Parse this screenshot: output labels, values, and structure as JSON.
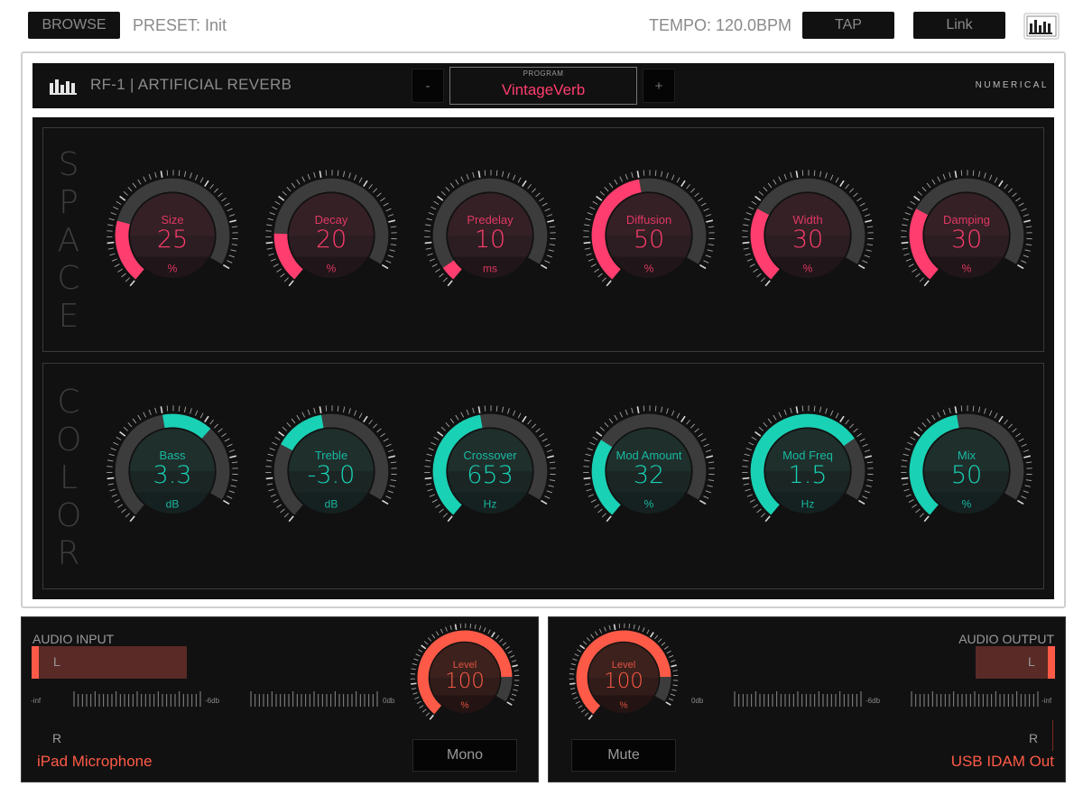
{
  "topbar": {
    "browse_label": "BROWSE",
    "preset": "PRESET: Init",
    "tempo": "TEMPO: 120.0BPM",
    "tap_label": "TAP",
    "link_label": "Link",
    "logo_icon": "bars-logo-icon"
  },
  "plugin": {
    "title": "RF-1 | ARTIFICIAL REVERB",
    "program_label": "PROGRAM",
    "program_name": "VintageVerb",
    "prev_label": "-",
    "next_label": "+",
    "brand": "NUMERICAL"
  },
  "colors": {
    "pink": "#ff3d6e",
    "teal": "#19d1b5",
    "orange": "#ff5a47"
  },
  "sections": [
    {
      "label": "SPACE",
      "color": "pink",
      "knobs": [
        {
          "name": "Size",
          "value": "25",
          "unit": "%",
          "fill": 0.25
        },
        {
          "name": "Decay",
          "value": "20",
          "unit": "%",
          "fill": 0.2
        },
        {
          "name": "Predelay",
          "value": "10",
          "unit": "ms",
          "fill": 0.06
        },
        {
          "name": "Diffusion",
          "value": "50",
          "unit": "%",
          "fill": 0.5
        },
        {
          "name": "Width",
          "value": "30",
          "unit": "%",
          "fill": 0.3
        },
        {
          "name": "Damping",
          "value": "30",
          "unit": "%",
          "fill": 0.3
        }
      ]
    },
    {
      "label": "COLOR",
      "color": "teal",
      "knobs": [
        {
          "name": "Bass",
          "value": "3.3",
          "unit": "dB",
          "from": 0.5,
          "fill": 0.7
        },
        {
          "name": "Treble",
          "value": "-3.0",
          "unit": "dB",
          "from": 0.3,
          "fill": 0.5
        },
        {
          "name": "Crossover",
          "value": "653",
          "unit": "Hz",
          "fill": 0.5
        },
        {
          "name": "Mod Amount",
          "value": "32",
          "unit": "%",
          "fill": 0.32
        },
        {
          "name": "Mod Freq",
          "value": "1.5",
          "unit": "Hz",
          "fill": 0.75
        },
        {
          "name": "Mix",
          "value": "50",
          "unit": "%",
          "fill": 0.5
        }
      ]
    }
  ],
  "audio_input": {
    "title": "AUDIO INPUT",
    "ch_left": "L",
    "ch_right": "R",
    "scale_min": "-inf",
    "scale_mid": "-6db",
    "scale_max": "0db",
    "knob": {
      "name": "Level",
      "value": "100",
      "unit": "%",
      "fill": 0.88
    },
    "mode_label": "Mono",
    "device": "iPad Microphone"
  },
  "audio_output": {
    "title": "AUDIO OUTPUT",
    "ch_left": "L",
    "ch_right": "R",
    "scale_min": "-inf",
    "scale_mid": "-6db",
    "scale_max": "0db",
    "knob": {
      "name": "Level",
      "value": "100",
      "unit": "%",
      "fill": 0.88
    },
    "mute_label": "Mute",
    "device": "USB IDAM Out"
  }
}
